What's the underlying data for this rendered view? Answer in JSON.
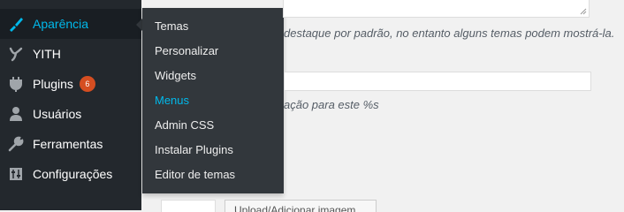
{
  "sidebar": {
    "items": [
      {
        "label": "Aparência",
        "icon": "paintbrush-icon",
        "current": true
      },
      {
        "label": "YITH",
        "icon": "yith-icon"
      },
      {
        "label": "Plugins",
        "icon": "plugin-icon",
        "badge": "6"
      },
      {
        "label": "Usuários",
        "icon": "user-icon"
      },
      {
        "label": "Ferramentas",
        "icon": "wrench-icon"
      },
      {
        "label": "Configurações",
        "icon": "settings-icon"
      }
    ]
  },
  "submenu": {
    "items": [
      "Temas",
      "Personalizar",
      "Widgets",
      "Menus",
      "Admin CSS",
      "Instalar Plugins",
      "Editor de temas"
    ],
    "active": "Menus"
  },
  "content": {
    "desc_1": "destaque por padrão, no entanto alguns temas podem mostrá-la.",
    "desc_2": "ação para este %s",
    "button_label": "Upload/Adicionar imagem"
  },
  "colors": {
    "sidebar_bg": "#23282d",
    "submenu_bg": "#32373c",
    "accent": "#00b9eb",
    "badge": "#d54e21"
  }
}
